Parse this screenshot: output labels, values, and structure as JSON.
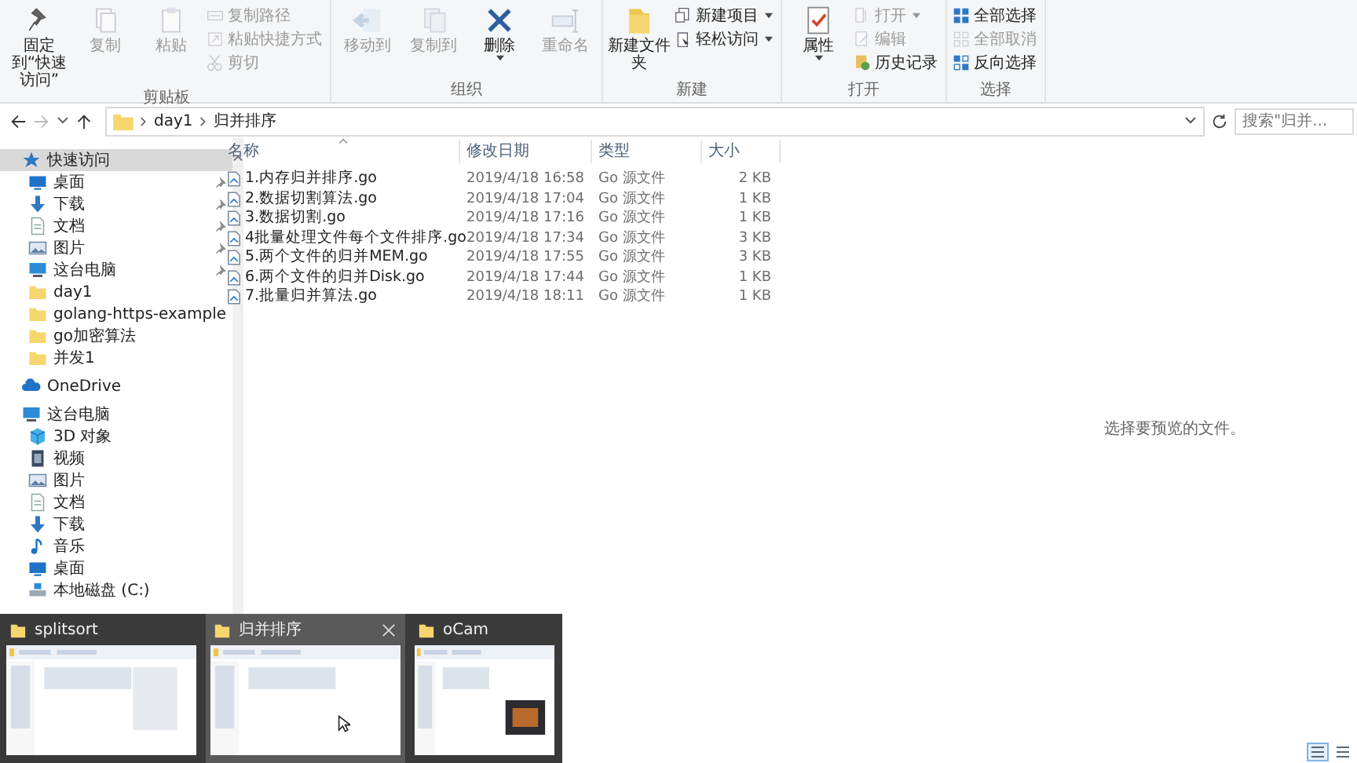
{
  "ribbon": {
    "groups": [
      {
        "label": "剪贴板",
        "items": [
          {
            "label": "固定到“快速访问”",
            "kind": "large",
            "disabled": false,
            "dropdown": false
          },
          {
            "label": "复制",
            "kind": "large",
            "disabled": true,
            "dropdown": false
          },
          {
            "label": "粘贴",
            "kind": "large",
            "disabled": true,
            "dropdown": false
          },
          {
            "label": "复制路径",
            "kind": "small",
            "disabled": true,
            "dropdown": false
          },
          {
            "label": "粘贴快捷方式",
            "kind": "small",
            "disabled": true,
            "dropdown": false
          },
          {
            "label": "剪切",
            "kind": "small",
            "disabled": true,
            "dropdown": false
          }
        ]
      },
      {
        "label": "组织",
        "items": [
          {
            "label": "移动到",
            "kind": "large",
            "disabled": true,
            "dropdown": false
          },
          {
            "label": "复制到",
            "kind": "large",
            "disabled": true,
            "dropdown": false
          },
          {
            "label": "删除",
            "kind": "large",
            "disabled": false,
            "dropdown": true
          },
          {
            "label": "重命名",
            "kind": "large",
            "disabled": true,
            "dropdown": false
          }
        ]
      },
      {
        "label": "新建",
        "items": [
          {
            "label": "新建文件夹",
            "kind": "large",
            "disabled": false,
            "dropdown": false
          },
          {
            "label": "新建项目",
            "kind": "small",
            "disabled": false,
            "dropdown": true
          },
          {
            "label": "轻松访问",
            "kind": "small",
            "disabled": false,
            "dropdown": true
          }
        ]
      },
      {
        "label": "打开",
        "items": [
          {
            "label": "属性",
            "kind": "large",
            "disabled": false,
            "dropdown": true
          },
          {
            "label": "打开",
            "kind": "small",
            "disabled": true,
            "dropdown": true
          },
          {
            "label": "编辑",
            "kind": "small",
            "disabled": true,
            "dropdown": false
          },
          {
            "label": "历史记录",
            "kind": "small",
            "disabled": false,
            "dropdown": false
          }
        ]
      },
      {
        "label": "选择",
        "items": [
          {
            "label": "全部选择",
            "kind": "small",
            "disabled": false,
            "dropdown": false
          },
          {
            "label": "全部取消",
            "kind": "small",
            "disabled": true,
            "dropdown": false
          },
          {
            "label": "反向选择",
            "kind": "small",
            "disabled": false,
            "dropdown": false
          }
        ]
      }
    ]
  },
  "address_bar": {
    "path": [
      "day1",
      "归并排序"
    ],
    "search": {
      "placeholder": "搜索\"归并..."
    }
  },
  "navigation": [
    {
      "label": "快速访问",
      "kind": "star",
      "selected": true,
      "pinned": false,
      "children": [
        {
          "label": "桌面",
          "kind": "desktop",
          "selected": false,
          "pinned": true
        },
        {
          "label": "下载",
          "kind": "download",
          "selected": false,
          "pinned": true
        },
        {
          "label": "文档",
          "kind": "document",
          "selected": false,
          "pinned": true
        },
        {
          "label": "图片",
          "kind": "pictures",
          "selected": false,
          "pinned": true
        },
        {
          "label": "这台电脑",
          "kind": "computer",
          "selected": false,
          "pinned": true
        },
        {
          "label": "day1",
          "kind": "folder",
          "selected": false,
          "pinned": false
        },
        {
          "label": "golang-https-example",
          "kind": "folder",
          "selected": false,
          "pinned": false
        },
        {
          "label": "go加密算法",
          "kind": "folder",
          "selected": false,
          "pinned": false
        },
        {
          "label": "并发1",
          "kind": "folder",
          "selected": false,
          "pinned": false
        }
      ]
    },
    {
      "label": "OneDrive",
      "kind": "cloud",
      "selected": false,
      "pinned": false
    },
    {
      "label": "这台电脑",
      "kind": "computer",
      "selected": false,
      "pinned": false,
      "children": [
        {
          "label": "3D 对象",
          "kind": "cube",
          "selected": false,
          "pinned": false
        },
        {
          "label": "视频",
          "kind": "video",
          "selected": false,
          "pinned": false
        },
        {
          "label": "图片",
          "kind": "pictures",
          "selected": false,
          "pinned": false
        },
        {
          "label": "文档",
          "kind": "document",
          "selected": false,
          "pinned": false
        },
        {
          "label": "下载",
          "kind": "download",
          "selected": false,
          "pinned": false
        },
        {
          "label": "音乐",
          "kind": "music",
          "selected": false,
          "pinned": false
        },
        {
          "label": "桌面",
          "kind": "desktop",
          "selected": false,
          "pinned": false
        },
        {
          "label": "本地磁盘 (C:)",
          "kind": "drive",
          "selected": false,
          "pinned": false
        }
      ]
    }
  ],
  "file_list": {
    "columns": [
      "名称",
      "修改日期",
      "类型",
      "大小"
    ],
    "rows": [
      {
        "name": "1.内存归并排序.go",
        "modified": "2019/4/18 16:58",
        "type": "Go 源文件",
        "size": "2 KB"
      },
      {
        "name": "2.数据切割算法.go",
        "modified": "2019/4/18 17:04",
        "type": "Go 源文件",
        "size": "1 KB"
      },
      {
        "name": "3.数据切割.go",
        "modified": "2019/4/18 17:16",
        "type": "Go 源文件",
        "size": "1 KB"
      },
      {
        "name": "4批量处理文件每个文件排序.go",
        "modified": "2019/4/18 17:34",
        "type": "Go 源文件",
        "size": "3 KB"
      },
      {
        "name": "5.两个文件的归并MEM.go",
        "modified": "2019/4/18 17:55",
        "type": "Go 源文件",
        "size": "3 KB"
      },
      {
        "name": "6.两个文件的归并Disk.go",
        "modified": "2019/4/18 17:44",
        "type": "Go 源文件",
        "size": "1 KB"
      },
      {
        "name": "7.批量归并算法.go",
        "modified": "2019/4/18 18:11",
        "type": "Go 源文件",
        "size": "1 KB"
      }
    ]
  },
  "preview_pane": {
    "message": "选择要预览的文件。"
  },
  "view_buttons": [
    {
      "selected": true
    },
    {
      "selected": false
    }
  ],
  "taskbar_previews": [
    {
      "title": "splitsort",
      "selected": false
    },
    {
      "title": "归并排序",
      "selected": true
    },
    {
      "title": "oCam",
      "selected": false
    }
  ]
}
